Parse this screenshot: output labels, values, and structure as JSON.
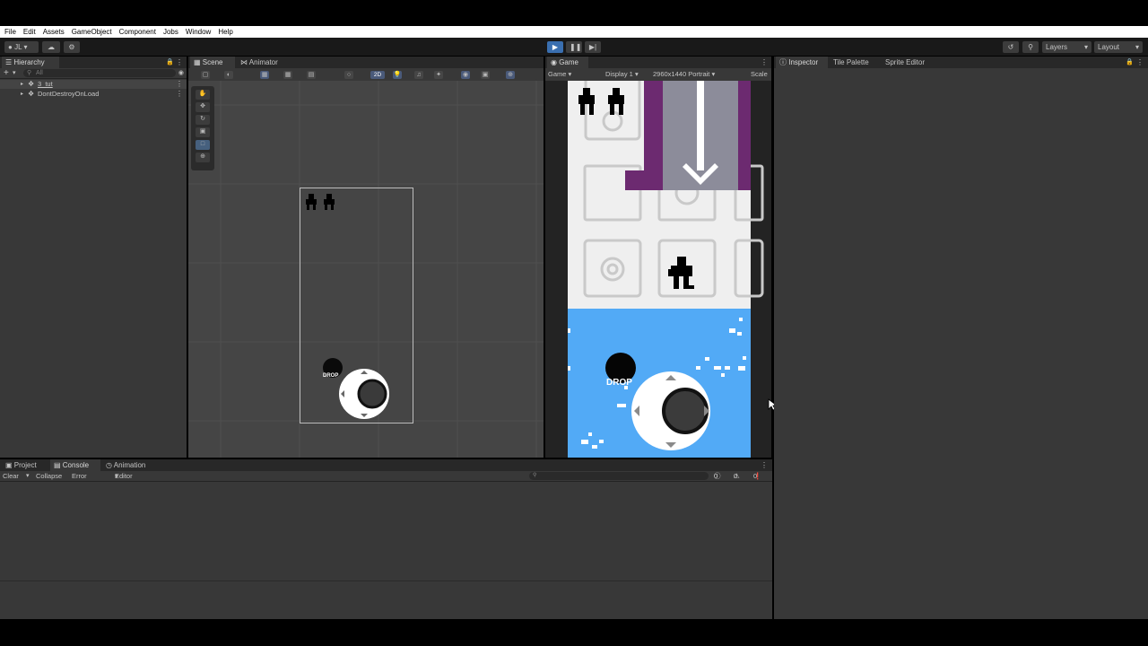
{
  "menubar": {
    "items": [
      "File",
      "Edit",
      "Assets",
      "GameObject",
      "Component",
      "Jobs",
      "Window",
      "Help"
    ]
  },
  "toolbar": {
    "account": "JL",
    "layers": "Layers",
    "layout": "Layout",
    "play_icon": "play-icon",
    "pause_icon": "pause-icon",
    "step_icon": "step-icon"
  },
  "hierarchy": {
    "tab": "Hierarchy",
    "search_placeholder": "All",
    "items": [
      "3_tut",
      "DontDestroyOnLoad"
    ]
  },
  "scene": {
    "tabs": [
      "Scene",
      "Animator"
    ],
    "mode_2d": "2D",
    "drop_label": "DROP"
  },
  "game": {
    "tab": "Game",
    "game_dropdown": "Game",
    "display": "Display 1",
    "resolution": "2960x1440 Portrait",
    "scale": "Scale",
    "drop_label": "DROP"
  },
  "inspector": {
    "tabs": [
      "Inspector",
      "Tile Palette",
      "Sprite Editor"
    ]
  },
  "bottom": {
    "tabs": [
      "Project",
      "Console",
      "Animation"
    ],
    "clear": "Clear",
    "collapse": "Collapse",
    "error_pause": "Error Pause",
    "editor": "Editor",
    "log_count": "0",
    "warning_count": "0",
    "error_count": "0"
  },
  "colors": {
    "game_blue": "#52aaf6",
    "purple": "#6c2a70",
    "play_blue": "#3a6fb0"
  }
}
